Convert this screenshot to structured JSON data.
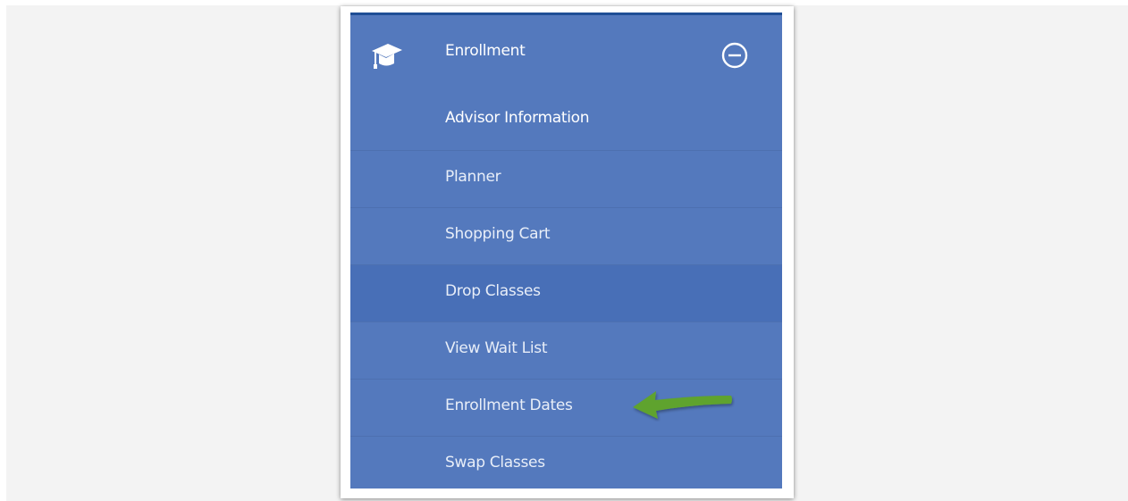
{
  "menu": {
    "title": "Enrollment",
    "icon": "graduation-cap-icon",
    "toggle_icon": "collapse-minus-icon",
    "accent_color": "#5479bd",
    "top_border_color": "#1f4e95",
    "items": [
      {
        "label": "Advisor Information",
        "active": false
      },
      {
        "label": "Planner",
        "active": false
      },
      {
        "label": "Shopping Cart",
        "active": false
      },
      {
        "label": "Drop Classes",
        "active": true
      },
      {
        "label": "View Wait List",
        "active": false
      },
      {
        "label": "Enrollment Dates",
        "active": false
      },
      {
        "label": "Swap Classes",
        "active": false
      }
    ]
  },
  "annotation": {
    "icon": "green-arrow-icon",
    "color": "#5fa32e",
    "points_to": "Enrollment Dates"
  }
}
